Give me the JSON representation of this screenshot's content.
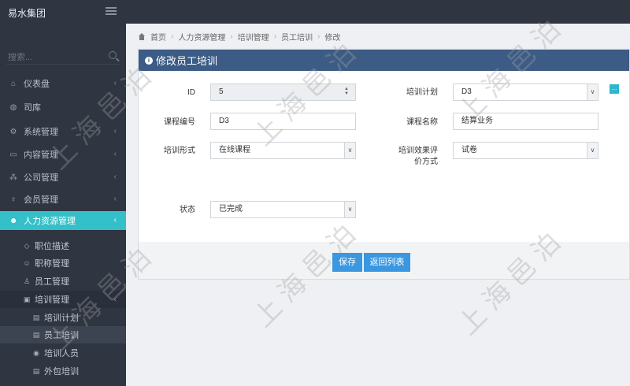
{
  "app": {
    "brand": "易水集团"
  },
  "sidebar": {
    "search_placeholder": "搜索...",
    "items": [
      {
        "label": "仪表盘",
        "icon": "home-icon"
      },
      {
        "label": "司库",
        "icon": "globe-icon"
      },
      {
        "label": "系统管理",
        "icon": "gears-icon"
      },
      {
        "label": "内容管理",
        "icon": "card-icon"
      },
      {
        "label": "公司管理",
        "icon": "sitemap-icon"
      },
      {
        "label": "会员管理",
        "icon": "trophy-icon"
      },
      {
        "label": "人力资源管理",
        "icon": "users-icon"
      }
    ],
    "sub_items": [
      {
        "label": "职位描述",
        "icon": "diamond-icon"
      },
      {
        "label": "职称管理",
        "icon": "user-group-icon"
      },
      {
        "label": "员工管理",
        "icon": "user-icon"
      },
      {
        "label": "培训管理",
        "icon": "briefcase-icon"
      }
    ],
    "sub_sub_items": [
      {
        "label": "培训计划",
        "icon": "card-icon"
      },
      {
        "label": "员工培训",
        "icon": "card-icon"
      },
      {
        "label": "培训人员",
        "icon": "eye-icon"
      },
      {
        "label": "外包培训",
        "icon": "card-icon"
      }
    ]
  },
  "breadcrumb": [
    "首页",
    "人力资源管理",
    "培训管理",
    "员工培训",
    "修改"
  ],
  "panel": {
    "title": "修改员工培训",
    "fields": {
      "id_label": "ID",
      "id_value": "5",
      "plan_label": "培训计划",
      "plan_value": "D3",
      "course_no_label": "课程编号",
      "course_no_value": "D3",
      "course_name_label": "课程名称",
      "course_name_value": "结算业务",
      "form_label": "培训形式",
      "form_value": "在线课程",
      "eval_label_1": "培训效果评",
      "eval_label_2": "价方式",
      "eval_value": "试卷",
      "status_label": "状态",
      "status_value": "已完成"
    },
    "save_label": "保存",
    "back_label": "返回列表",
    "add_label": "..."
  },
  "watermark": "上海邑泊",
  "colors": {
    "sidebar_bg": "#2f3541",
    "accent": "#33c0c8",
    "panel_head": "#3c5c85",
    "button": "#3a97e0"
  }
}
